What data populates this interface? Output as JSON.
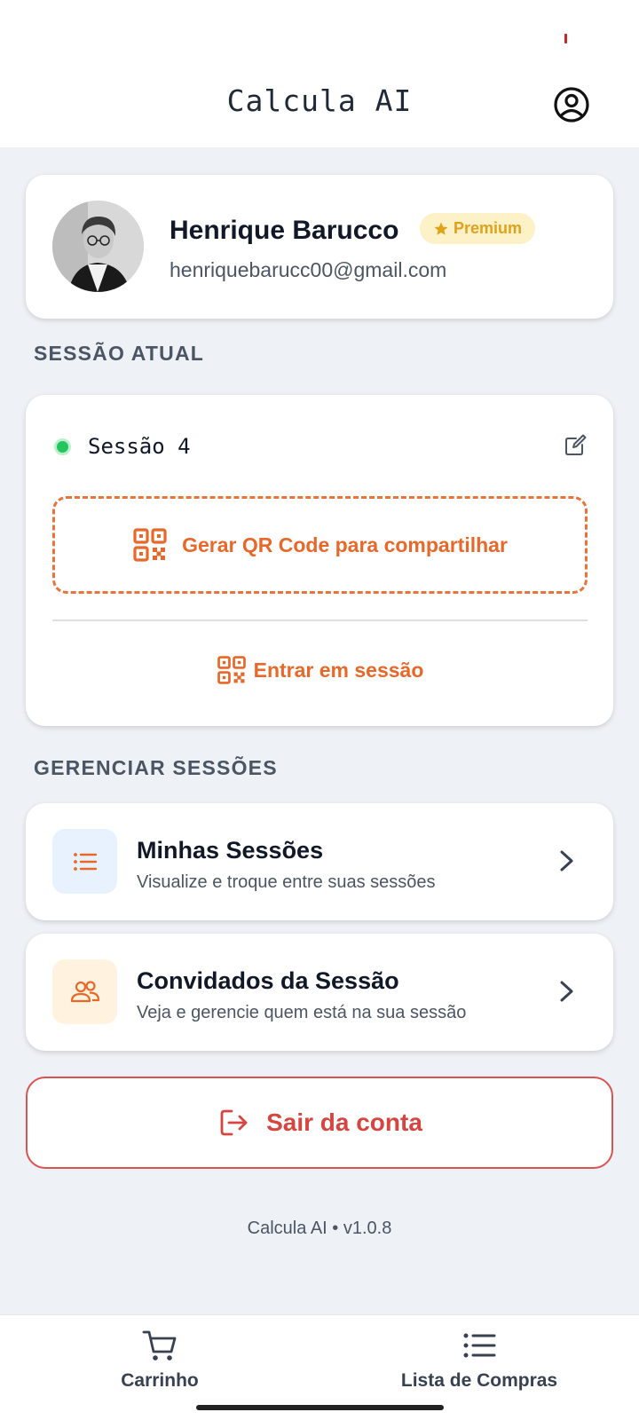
{
  "header": {
    "title": "Calcula AI",
    "profile_icon": "user-circle-icon"
  },
  "profile": {
    "name": "Henrique Barucco",
    "badge": {
      "icon": "star-icon",
      "label": "Premium"
    },
    "email": "henriquebarucc00@gmail.com"
  },
  "current_session": {
    "section_title": "SESSÃO ATUAL",
    "status": "active",
    "name": "Sessão 4",
    "share_label": "Gerar QR Code para compartilhar",
    "join_label": "Entrar em sessão"
  },
  "manage_sessions": {
    "section_title": "GERENCIAR SESSÕES",
    "items": [
      {
        "icon": "list-icon",
        "title": "Minhas Sessões",
        "subtitle": "Visualize e troque entre suas sessões"
      },
      {
        "icon": "users-icon",
        "title": "Convidados da Sessão",
        "subtitle": "Veja e gerencie quem está na sua sessão"
      }
    ]
  },
  "logout": {
    "label": "Sair da conta",
    "icon": "logout-icon"
  },
  "footer": {
    "version_text": "Calcula AI • v1.0.8"
  },
  "bottom_nav": {
    "items": [
      {
        "icon": "cart-icon",
        "label": "Carrinho"
      },
      {
        "icon": "list-icon",
        "label": "Lista de Compras"
      }
    ]
  },
  "colors": {
    "accent": "#e8682a",
    "premium_bg": "#fdf1c8",
    "premium_text": "#e0a21a",
    "danger": "#d64540",
    "active_status": "#22c55e",
    "background": "#eef1f5"
  }
}
